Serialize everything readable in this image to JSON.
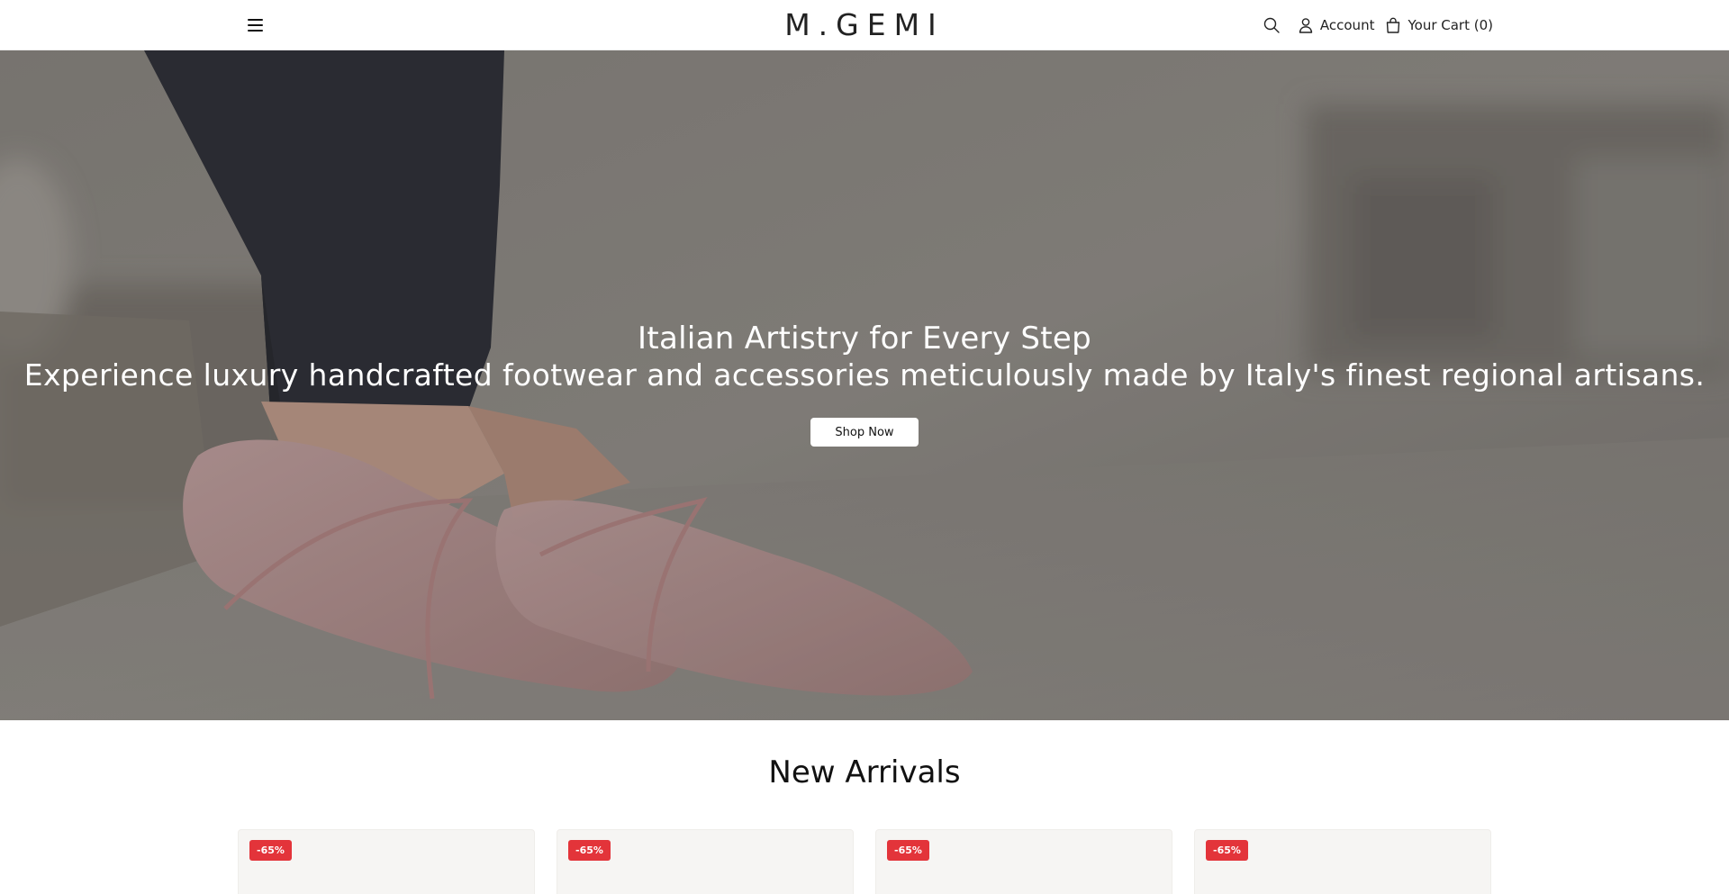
{
  "header": {
    "logo_text": "M.GEMI",
    "account_label": "Account",
    "cart_label": "Your Cart (0)"
  },
  "hero": {
    "title": "Italian Artistry for Every Step",
    "subtitle": "Experience luxury handcrafted footwear and accessories meticulously made by Italy's finest regional artisans.",
    "cta_label": "Shop Now"
  },
  "new_arrivals": {
    "title": "New Arrivals",
    "products": [
      {
        "badge": "-65%"
      },
      {
        "badge": "-65%"
      },
      {
        "badge": "-65%"
      },
      {
        "badge": "-65%"
      }
    ]
  },
  "icons": {
    "menu": "hamburger-menu-icon",
    "search": "search-icon",
    "account": "user-icon",
    "cart": "shopping-bag-icon"
  },
  "colors": {
    "badge": "#e3343a",
    "cta_background": "#ffffff",
    "header_background": "#ffffff"
  }
}
